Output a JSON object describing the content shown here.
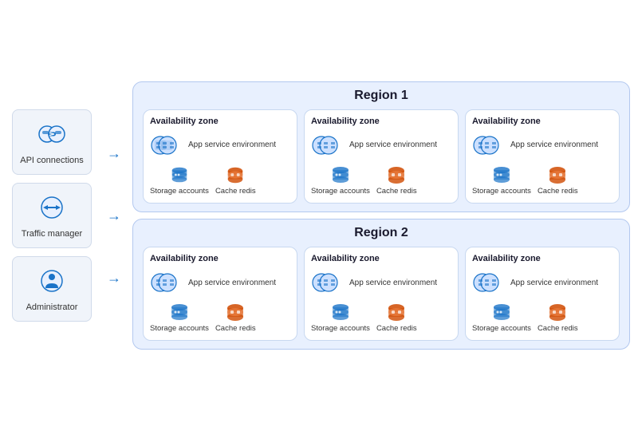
{
  "sidebar": {
    "items": [
      {
        "id": "api-connections",
        "label": "API connections"
      },
      {
        "id": "traffic-manager",
        "label": "Traffic manager"
      },
      {
        "id": "administrator",
        "label": "Administrator"
      }
    ]
  },
  "regions": [
    {
      "id": "region1",
      "title": "Region 1",
      "zones": [
        {
          "id": "zone1-1",
          "title": "Availability zone",
          "app_label": "App service environment",
          "storage_label": "Storage accounts",
          "cache_label": "Cache redis"
        },
        {
          "id": "zone1-2",
          "title": "Availability zone",
          "app_label": "App service environment",
          "storage_label": "Storage accounts",
          "cache_label": "Cache redis"
        },
        {
          "id": "zone1-3",
          "title": "Availability zone",
          "app_label": "App service environment",
          "storage_label": "Storage accounts",
          "cache_label": "Cache redis"
        }
      ]
    },
    {
      "id": "region2",
      "title": "Region 2",
      "zones": [
        {
          "id": "zone2-1",
          "title": "Availability zone",
          "app_label": "App service environment",
          "storage_label": "Storage accounts",
          "cache_label": "Cache redis"
        },
        {
          "id": "zone2-2",
          "title": "Availability zone",
          "app_label": "App service environment",
          "storage_label": "Storage accounts",
          "cache_label": "Cache redis"
        },
        {
          "id": "zone2-3",
          "title": "Availability zone",
          "app_label": "App service environment",
          "storage_label": "Storage accounts",
          "cache_label": "Cache redis"
        }
      ]
    }
  ]
}
